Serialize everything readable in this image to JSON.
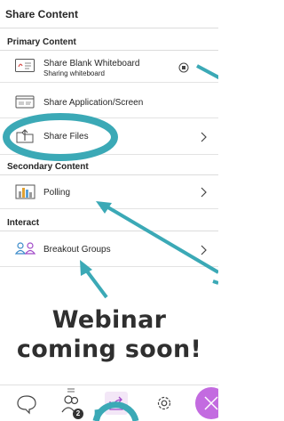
{
  "header": {
    "title": "Share Content"
  },
  "sections": {
    "primary": "Primary Content",
    "secondary": "Secondary Content",
    "interact": "Interact"
  },
  "items": {
    "whiteboard": {
      "label": "Share Blank Whiteboard",
      "status": "Sharing whiteboard",
      "icon": "whiteboard-icon",
      "action_icon": "stop-sharing-icon"
    },
    "app": {
      "label": "Share Application/Screen",
      "icon": "screen-share-icon"
    },
    "files": {
      "label": "Share Files",
      "icon": "folder-upload-icon"
    },
    "polling": {
      "label": "Polling",
      "icon": "bar-chart-icon"
    },
    "breakout": {
      "label": "Breakout Groups",
      "icon": "groups-icon"
    }
  },
  "callout": {
    "line1": "Webinar",
    "line2": "coming soon!"
  },
  "tabbar": {
    "participants_badge": "2",
    "tabs": [
      "chat-icon",
      "participants-icon",
      "share-content-icon",
      "settings-icon",
      "close-icon"
    ]
  },
  "colors": {
    "accent_purple": "#a14ac8",
    "share_tab_bg": "#f3e7f7",
    "annotation_teal": "#3ba9b6",
    "close_button": "#c36be0"
  }
}
